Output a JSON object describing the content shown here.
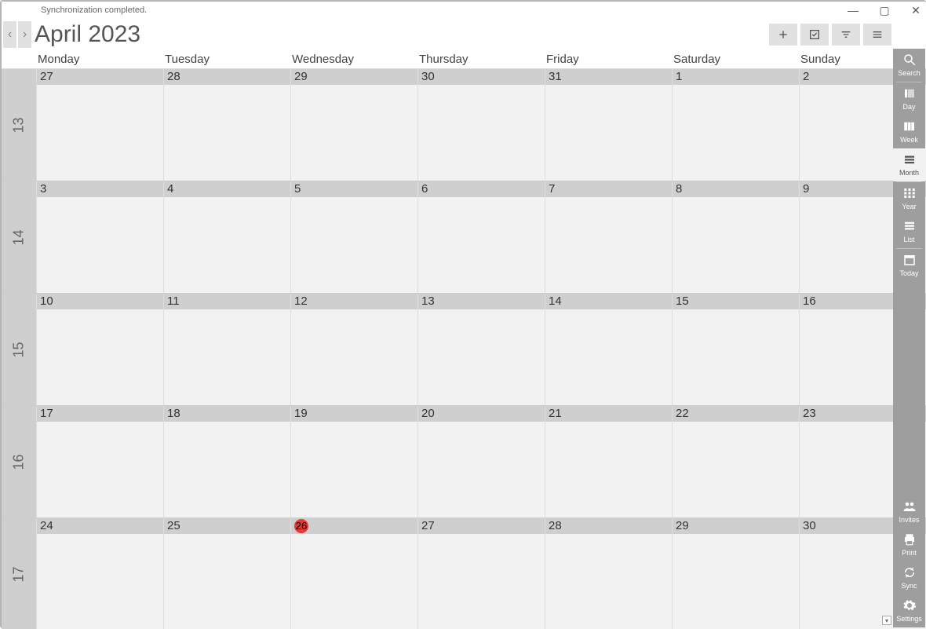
{
  "status_text": "Synchronization completed.",
  "title": "April 2023",
  "daynames": [
    "Monday",
    "Tuesday",
    "Wednesday",
    "Thursday",
    "Friday",
    "Saturday",
    "Sunday"
  ],
  "weeks": [
    {
      "num": "13",
      "days": [
        "27",
        "28",
        "29",
        "30",
        "31",
        "1",
        "2"
      ]
    },
    {
      "num": "14",
      "days": [
        "3",
        "4",
        "5",
        "6",
        "7",
        "8",
        "9"
      ]
    },
    {
      "num": "15",
      "days": [
        "10",
        "11",
        "12",
        "13",
        "14",
        "15",
        "16"
      ]
    },
    {
      "num": "16",
      "days": [
        "17",
        "18",
        "19",
        "20",
        "21",
        "22",
        "23"
      ]
    },
    {
      "num": "17",
      "days": [
        "24",
        "25",
        "26",
        "27",
        "28",
        "29",
        "30"
      ]
    }
  ],
  "today": {
    "week": 4,
    "day": 2
  },
  "sidebar": {
    "search": "Search",
    "day": "Day",
    "week": "Week",
    "month": "Month",
    "year": "Year",
    "list": "List",
    "today": "Today",
    "invites": "Invites",
    "print": "Print",
    "sync": "Sync",
    "settings": "Settings"
  }
}
